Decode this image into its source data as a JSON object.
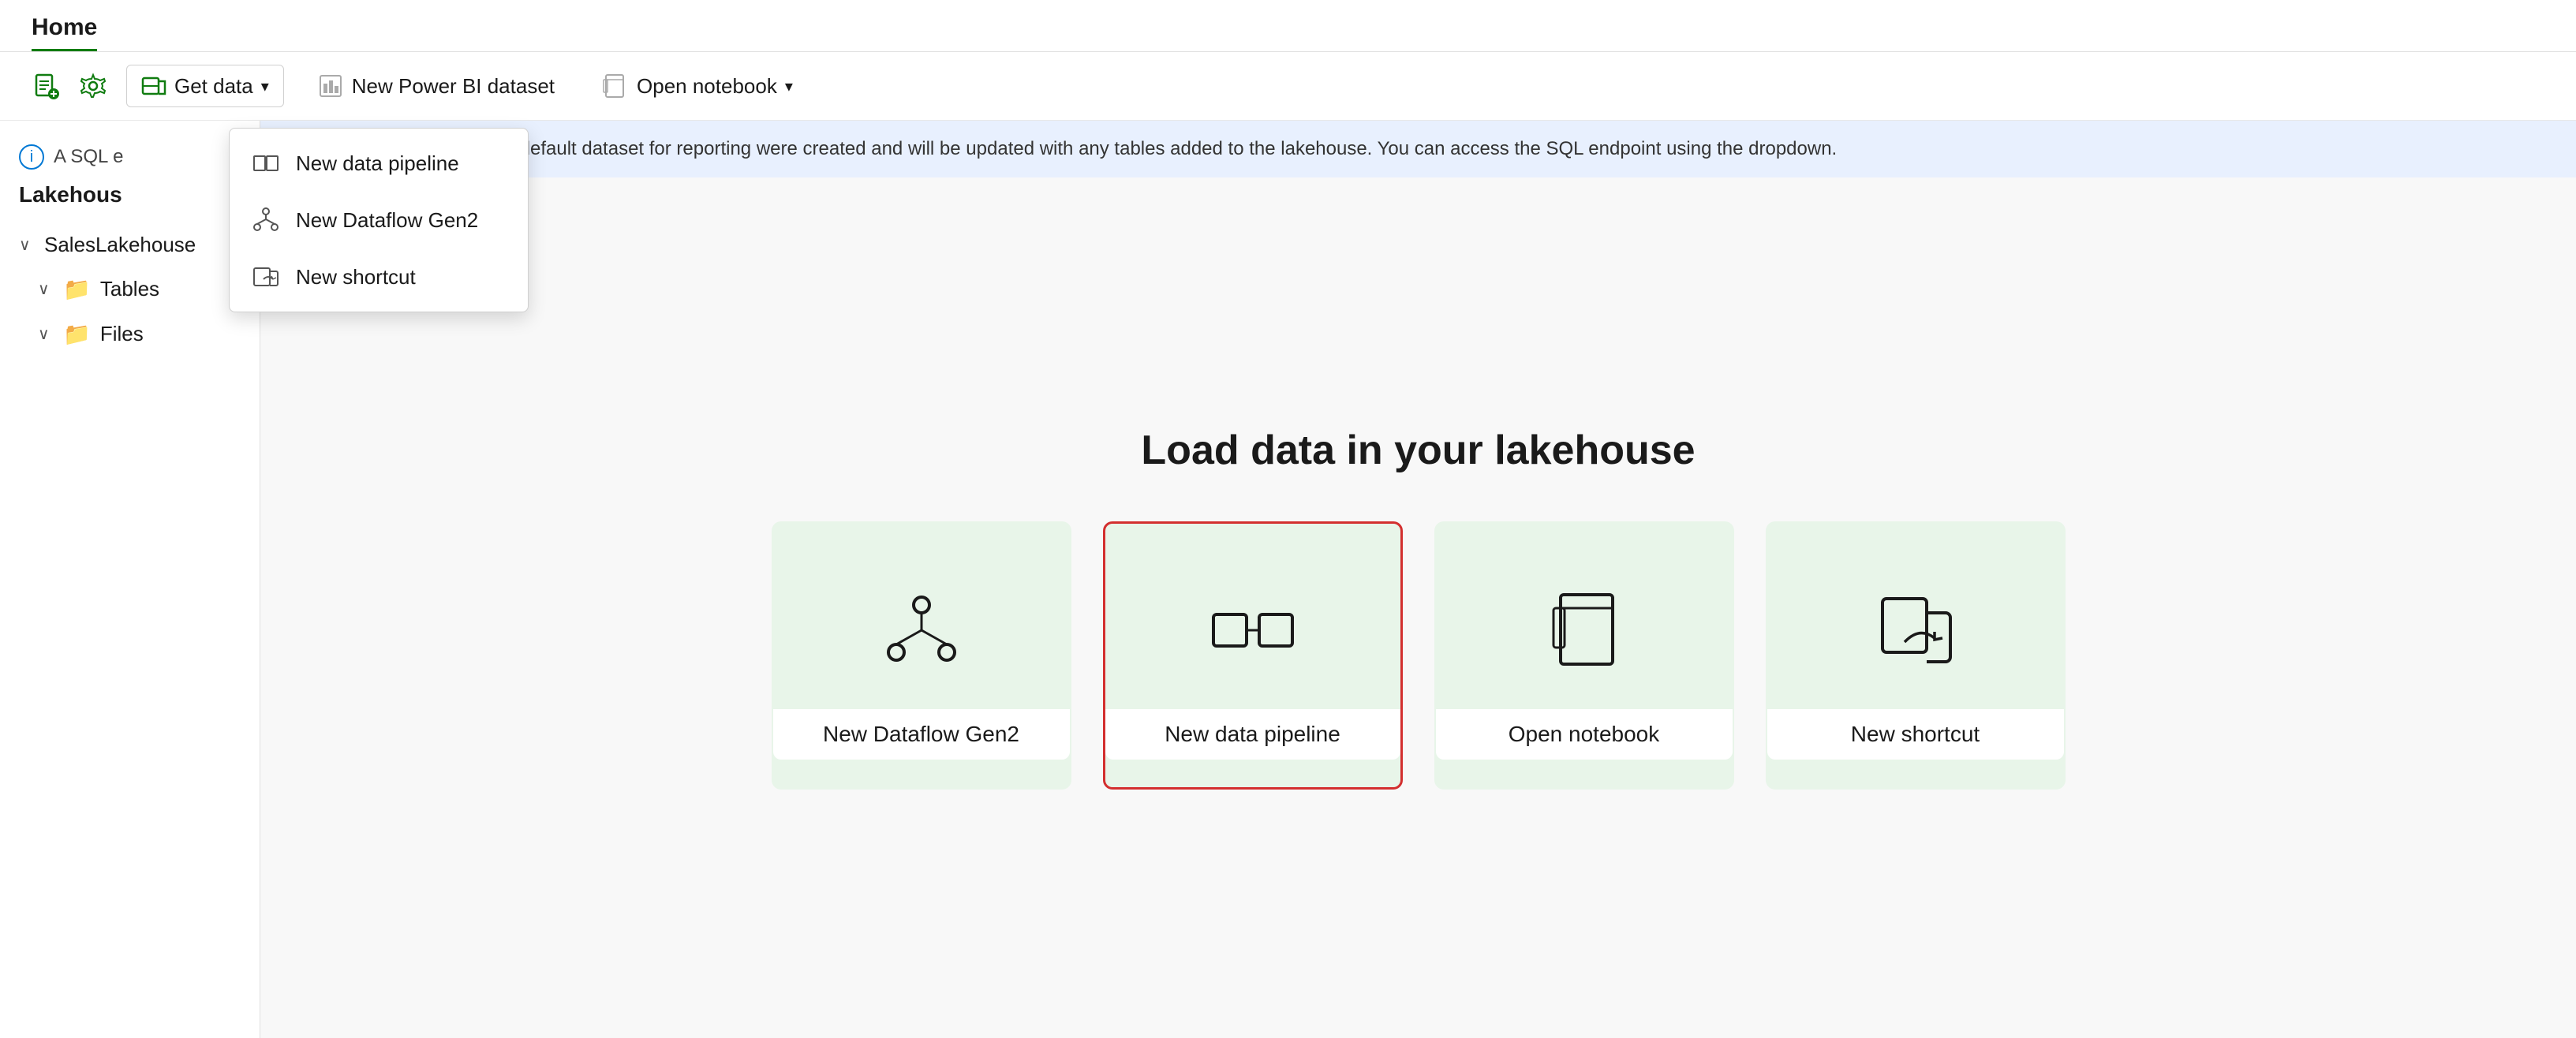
{
  "titleBar": {
    "title": "Home"
  },
  "toolbar": {
    "newFileLabel": "",
    "settingsLabel": "",
    "getDataLabel": "Get data",
    "newPowerBILabel": "New Power BI dataset",
    "openNotebookLabel": "Open notebook"
  },
  "dropdown": {
    "items": [
      {
        "id": "pipeline",
        "label": "New data pipeline"
      },
      {
        "id": "dataflow",
        "label": "New Dataflow Gen2"
      },
      {
        "id": "shortcut",
        "label": "New shortcut"
      }
    ]
  },
  "sidebar": {
    "infoLabel": "A SQL e",
    "lakehouseTitle": "Lakehous",
    "items": [
      {
        "id": "salesLakehouse",
        "label": "SalesLakehouse",
        "type": "root"
      },
      {
        "id": "tables",
        "label": "Tables",
        "type": "folder"
      },
      {
        "id": "files",
        "label": "Files",
        "type": "folder"
      }
    ]
  },
  "infoBanner": {
    "text": "A SQL endpoint and a default dataset for reporting were created and will be updated with any tables added to the lakehouse. You can access the SQL endpoint using the dropdown."
  },
  "main": {
    "sectionTitle": "Load data in your lakehouse",
    "cards": [
      {
        "id": "dataflow",
        "label": "New Dataflow Gen2",
        "selected": false
      },
      {
        "id": "pipeline",
        "label": "New data pipeline",
        "selected": true
      },
      {
        "id": "notebook",
        "label": "Open notebook",
        "selected": false
      },
      {
        "id": "shortcut",
        "label": "New shortcut",
        "selected": false
      }
    ]
  }
}
